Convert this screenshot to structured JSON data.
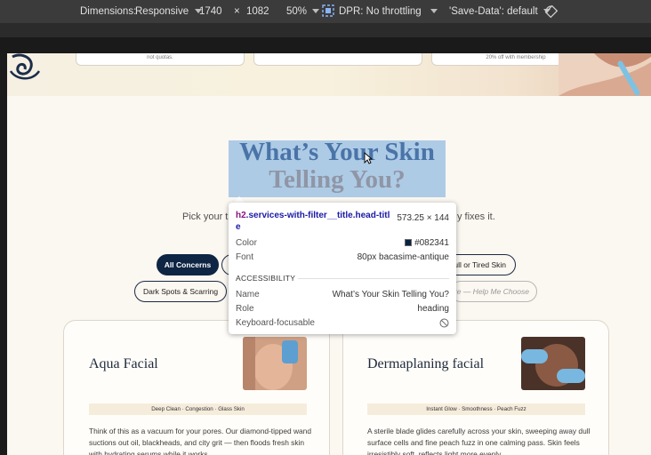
{
  "devtools": {
    "dimensions_label": "Dimensions:",
    "device": "Responsive",
    "width": "1740",
    "times": "×",
    "height": "1082",
    "zoom": "50%",
    "dpr": "DPR: No throttling",
    "save_data": "'Save-Data': default"
  },
  "hero_cards": [
    {
      "text": "not quotas."
    },
    {
      "text": ""
    },
    {
      "text": "20% off with membership"
    }
  ],
  "section": {
    "title_line1": "What’s Your Skin",
    "title_line2": "Telling You?",
    "subtitle_left": "Pick your t",
    "subtitle_right": "y fixes it."
  },
  "filters": [
    {
      "label": "All Concerns",
      "active": true
    },
    {
      "label": "ull or Tired Skin",
      "active": false
    },
    {
      "label": "Dark Spots & Scarring",
      "active": false
    },
    {
      "label": "ure — Help Me Choose",
      "active": false
    }
  ],
  "cards": [
    {
      "title": "Aqua Facial",
      "tags": "Deep Clean · Congestion · Glass Skin",
      "description": "Think of this as a vacuum for your pores. Our diamond-tipped wand suctions out oil, blackheads, and city grit — then floods fresh skin with hydrating serums while it works."
    },
    {
      "title": "Dermaplaning facial",
      "tags": "Instant Glow · Smoothness · Peach Fuzz",
      "description": "A sterile blade glides carefully across your skin, sweeping away dull surface cells and fine peach fuzz in one calming pass. Skin feels irresistibly soft, reflects light more evenly."
    }
  ],
  "tooltip": {
    "tag": "h2",
    "selector": ".services-with-filter__title.head-title",
    "dimensions": "573.25 × 144",
    "color_label": "Color",
    "color_value": "#082341",
    "font_label": "Font",
    "font_value": "80px bacasime-antique",
    "accessibility_heading": "ACCESSIBILITY",
    "name_label": "Name",
    "name_value": "What’s Your Skin Telling You?",
    "role_label": "Role",
    "role_value": "heading",
    "keyboard_label": "Keyboard-focusable"
  },
  "colors": {
    "heading": "#082341",
    "highlight": "#6fa8dc",
    "chip_active": "#0e2544"
  }
}
